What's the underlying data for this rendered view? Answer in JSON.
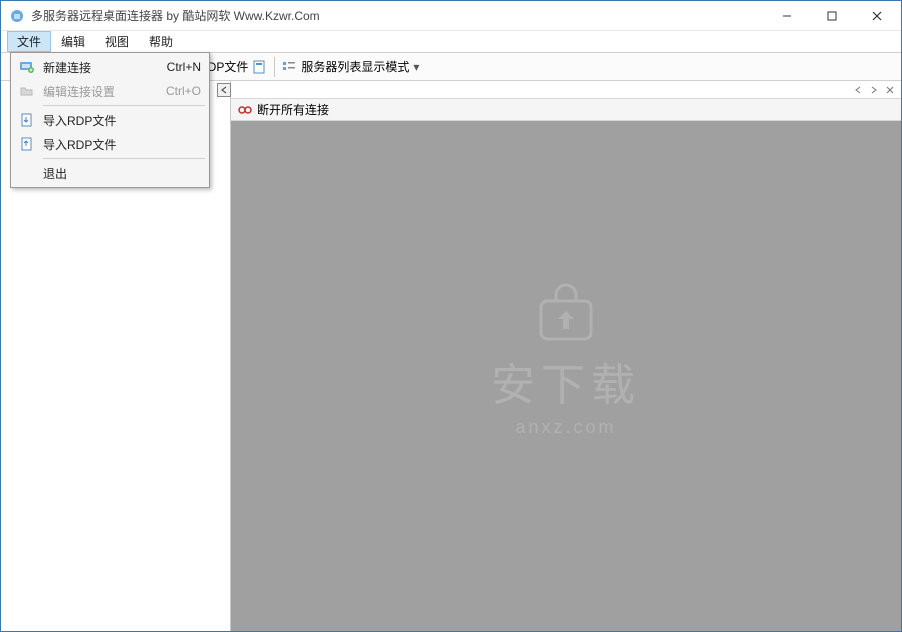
{
  "window": {
    "title": "多服务器远程桌面连接器 by 酷站网软 Www.Kzwr.Com"
  },
  "menubar": {
    "file": "文件",
    "edit": "编辑",
    "view": "视图",
    "help": "帮助"
  },
  "file_menu": {
    "new_conn": "新建连接",
    "new_conn_sc": "Ctrl+N",
    "edit_conn": "编辑连接设置",
    "edit_conn_sc": "Ctrl+O",
    "export_rdp": "导入RDP文件",
    "import_rdp": "导入RDP文件",
    "exit": "退出"
  },
  "toolbar": {
    "rdp_file": "RDP文件",
    "display_mode": "服务器列表显示模式"
  },
  "infobar": {
    "disconnect_all": "断开所有连接"
  },
  "watermark": {
    "main": "安下载",
    "sub": "anxz.com"
  }
}
